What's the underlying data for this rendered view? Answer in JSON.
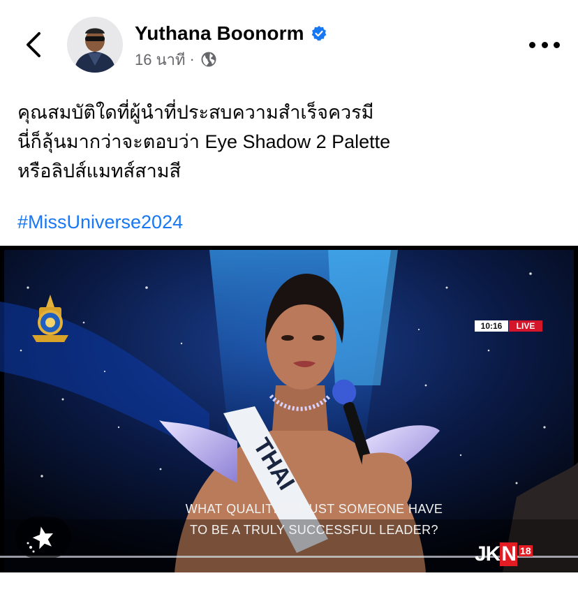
{
  "post": {
    "author": "Yuthana Boonorm",
    "time": "16 นาที",
    "separator": "·",
    "text_lines": [
      "คุณสมบัติใดที่ผู้นำที่ประสบความสำเร็จควรมี",
      "นี่ก็ลุ้นมากว่าจะตอบว่า Eye Shadow 2 Palette",
      "หรือลิปส์แมทส์สามสี"
    ],
    "hashtag": "#MissUniverse2024"
  },
  "media": {
    "sash_text": "THAI",
    "caption_lines": [
      "WHAT QUALITIES MUST SOMEONE HAVE",
      "TO BE A TRULY SUCCESSFUL LEADER?"
    ],
    "broadcaster": {
      "logo_prefix": "JK",
      "logo_n": "N",
      "channel": "18",
      "clock": "10:16",
      "live": "LIVE"
    }
  },
  "icons": {
    "back": "chevron-left-icon",
    "verified": "verified-badge-icon",
    "audience": "globe-icon",
    "more": "more-horizontal-icon",
    "effects": "sparkle-effects-icon"
  },
  "colors": {
    "link": "#1877f2",
    "verified": "#1877f2",
    "meta": "#65676b",
    "live": "#d4152a"
  }
}
